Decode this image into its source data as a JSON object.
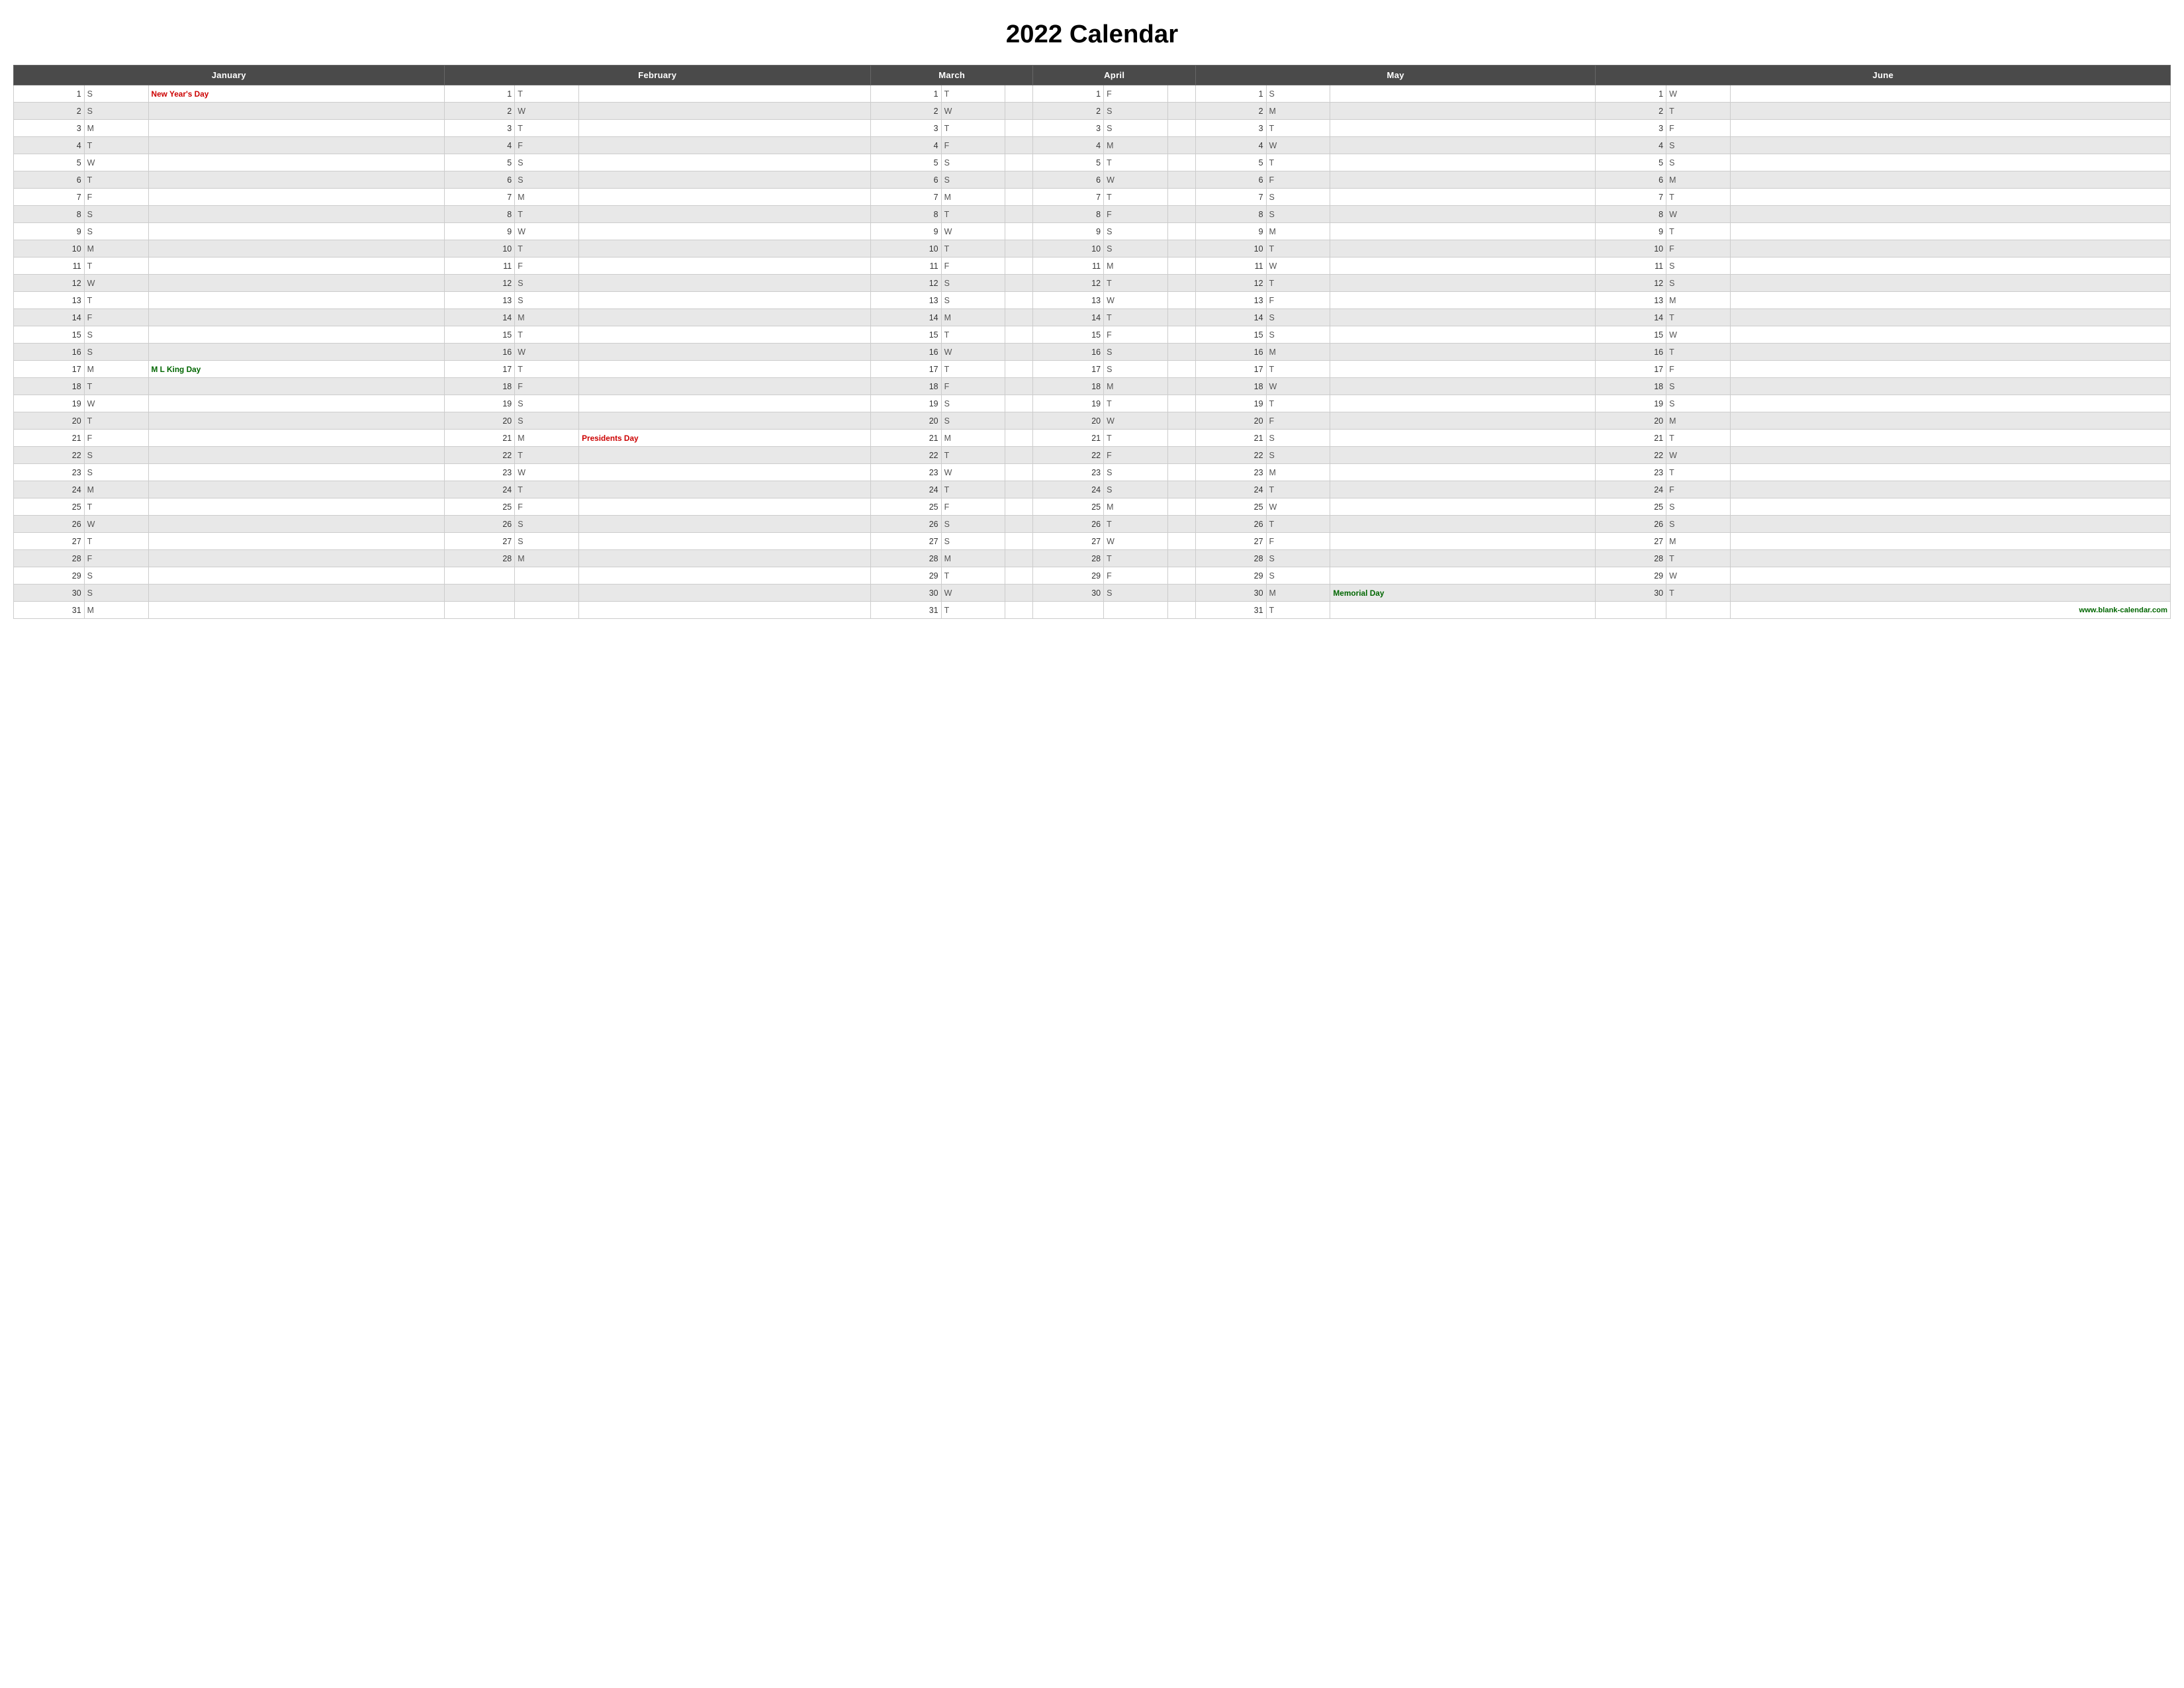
{
  "title": "2022 Calendar",
  "months": [
    "January",
    "February",
    "March",
    "April",
    "May",
    "June"
  ],
  "watermark": "www.blank-calendar.com",
  "rows": [
    {
      "jan": {
        "d": 1,
        "l": "S",
        "holiday": "New Year's Day",
        "hclass": "holiday-text"
      },
      "feb": {
        "d": 1,
        "l": "T",
        "holiday": ""
      },
      "mar": {
        "d": 1,
        "l": "T",
        "holiday": ""
      },
      "apr": {
        "d": 1,
        "l": "F",
        "holiday": ""
      },
      "may": {
        "d": 1,
        "l": "S",
        "holiday": ""
      },
      "jun": {
        "d": 1,
        "l": "W",
        "holiday": ""
      }
    },
    {
      "jan": {
        "d": 2,
        "l": "S",
        "holiday": ""
      },
      "feb": {
        "d": 2,
        "l": "W",
        "holiday": ""
      },
      "mar": {
        "d": 2,
        "l": "W",
        "holiday": ""
      },
      "apr": {
        "d": 2,
        "l": "S",
        "holiday": ""
      },
      "may": {
        "d": 2,
        "l": "M",
        "holiday": ""
      },
      "jun": {
        "d": 2,
        "l": "T",
        "holiday": ""
      }
    },
    {
      "jan": {
        "d": 3,
        "l": "M",
        "holiday": ""
      },
      "feb": {
        "d": 3,
        "l": "T",
        "holiday": ""
      },
      "mar": {
        "d": 3,
        "l": "T",
        "holiday": ""
      },
      "apr": {
        "d": 3,
        "l": "S",
        "holiday": ""
      },
      "may": {
        "d": 3,
        "l": "T",
        "holiday": ""
      },
      "jun": {
        "d": 3,
        "l": "F",
        "holiday": ""
      }
    },
    {
      "jan": {
        "d": 4,
        "l": "T",
        "holiday": ""
      },
      "feb": {
        "d": 4,
        "l": "F",
        "holiday": ""
      },
      "mar": {
        "d": 4,
        "l": "F",
        "holiday": ""
      },
      "apr": {
        "d": 4,
        "l": "M",
        "holiday": ""
      },
      "may": {
        "d": 4,
        "l": "W",
        "holiday": ""
      },
      "jun": {
        "d": 4,
        "l": "S",
        "holiday": ""
      }
    },
    {
      "jan": {
        "d": 5,
        "l": "W",
        "holiday": ""
      },
      "feb": {
        "d": 5,
        "l": "S",
        "holiday": ""
      },
      "mar": {
        "d": 5,
        "l": "S",
        "holiday": ""
      },
      "apr": {
        "d": 5,
        "l": "T",
        "holiday": ""
      },
      "may": {
        "d": 5,
        "l": "T",
        "holiday": ""
      },
      "jun": {
        "d": 5,
        "l": "S",
        "holiday": ""
      }
    },
    {
      "jan": {
        "d": 6,
        "l": "T",
        "holiday": ""
      },
      "feb": {
        "d": 6,
        "l": "S",
        "holiday": ""
      },
      "mar": {
        "d": 6,
        "l": "S",
        "holiday": ""
      },
      "apr": {
        "d": 6,
        "l": "W",
        "holiday": ""
      },
      "may": {
        "d": 6,
        "l": "F",
        "holiday": ""
      },
      "jun": {
        "d": 6,
        "l": "M",
        "holiday": ""
      }
    },
    {
      "jan": {
        "d": 7,
        "l": "F",
        "holiday": ""
      },
      "feb": {
        "d": 7,
        "l": "M",
        "holiday": ""
      },
      "mar": {
        "d": 7,
        "l": "M",
        "holiday": ""
      },
      "apr": {
        "d": 7,
        "l": "T",
        "holiday": ""
      },
      "may": {
        "d": 7,
        "l": "S",
        "holiday": ""
      },
      "jun": {
        "d": 7,
        "l": "T",
        "holiday": ""
      }
    },
    {
      "jan": {
        "d": 8,
        "l": "S",
        "holiday": ""
      },
      "feb": {
        "d": 8,
        "l": "T",
        "holiday": ""
      },
      "mar": {
        "d": 8,
        "l": "T",
        "holiday": ""
      },
      "apr": {
        "d": 8,
        "l": "F",
        "holiday": ""
      },
      "may": {
        "d": 8,
        "l": "S",
        "holiday": ""
      },
      "jun": {
        "d": 8,
        "l": "W",
        "holiday": ""
      }
    },
    {
      "jan": {
        "d": 9,
        "l": "S",
        "holiday": ""
      },
      "feb": {
        "d": 9,
        "l": "W",
        "holiday": ""
      },
      "mar": {
        "d": 9,
        "l": "W",
        "holiday": ""
      },
      "apr": {
        "d": 9,
        "l": "S",
        "holiday": ""
      },
      "may": {
        "d": 9,
        "l": "M",
        "holiday": ""
      },
      "jun": {
        "d": 9,
        "l": "T",
        "holiday": ""
      }
    },
    {
      "jan": {
        "d": 10,
        "l": "M",
        "holiday": ""
      },
      "feb": {
        "d": 10,
        "l": "T",
        "holiday": ""
      },
      "mar": {
        "d": 10,
        "l": "T",
        "holiday": ""
      },
      "apr": {
        "d": 10,
        "l": "S",
        "holiday": ""
      },
      "may": {
        "d": 10,
        "l": "T",
        "holiday": ""
      },
      "jun": {
        "d": 10,
        "l": "F",
        "holiday": ""
      }
    },
    {
      "jan": {
        "d": 11,
        "l": "T",
        "holiday": ""
      },
      "feb": {
        "d": 11,
        "l": "F",
        "holiday": ""
      },
      "mar": {
        "d": 11,
        "l": "F",
        "holiday": ""
      },
      "apr": {
        "d": 11,
        "l": "M",
        "holiday": ""
      },
      "may": {
        "d": 11,
        "l": "W",
        "holiday": ""
      },
      "jun": {
        "d": 11,
        "l": "S",
        "holiday": ""
      }
    },
    {
      "jan": {
        "d": 12,
        "l": "W",
        "holiday": ""
      },
      "feb": {
        "d": 12,
        "l": "S",
        "holiday": ""
      },
      "mar": {
        "d": 12,
        "l": "S",
        "holiday": ""
      },
      "apr": {
        "d": 12,
        "l": "T",
        "holiday": ""
      },
      "may": {
        "d": 12,
        "l": "T",
        "holiday": ""
      },
      "jun": {
        "d": 12,
        "l": "S",
        "holiday": ""
      }
    },
    {
      "jan": {
        "d": 13,
        "l": "T",
        "holiday": ""
      },
      "feb": {
        "d": 13,
        "l": "S",
        "holiday": ""
      },
      "mar": {
        "d": 13,
        "l": "S",
        "holiday": ""
      },
      "apr": {
        "d": 13,
        "l": "W",
        "holiday": ""
      },
      "may": {
        "d": 13,
        "l": "F",
        "holiday": ""
      },
      "jun": {
        "d": 13,
        "l": "M",
        "holiday": ""
      }
    },
    {
      "jan": {
        "d": 14,
        "l": "F",
        "holiday": ""
      },
      "feb": {
        "d": 14,
        "l": "M",
        "holiday": ""
      },
      "mar": {
        "d": 14,
        "l": "M",
        "holiday": ""
      },
      "apr": {
        "d": 14,
        "l": "T",
        "holiday": ""
      },
      "may": {
        "d": 14,
        "l": "S",
        "holiday": ""
      },
      "jun": {
        "d": 14,
        "l": "T",
        "holiday": ""
      }
    },
    {
      "jan": {
        "d": 15,
        "l": "S",
        "holiday": ""
      },
      "feb": {
        "d": 15,
        "l": "T",
        "holiday": ""
      },
      "mar": {
        "d": 15,
        "l": "T",
        "holiday": ""
      },
      "apr": {
        "d": 15,
        "l": "F",
        "holiday": ""
      },
      "may": {
        "d": 15,
        "l": "S",
        "holiday": ""
      },
      "jun": {
        "d": 15,
        "l": "W",
        "holiday": ""
      }
    },
    {
      "jan": {
        "d": 16,
        "l": "S",
        "holiday": ""
      },
      "feb": {
        "d": 16,
        "l": "W",
        "holiday": ""
      },
      "mar": {
        "d": 16,
        "l": "W",
        "holiday": ""
      },
      "apr": {
        "d": 16,
        "l": "S",
        "holiday": ""
      },
      "may": {
        "d": 16,
        "l": "M",
        "holiday": ""
      },
      "jun": {
        "d": 16,
        "l": "T",
        "holiday": ""
      }
    },
    {
      "jan": {
        "d": 17,
        "l": "M",
        "holiday": "M L King Day",
        "hclass": "holiday-green"
      },
      "feb": {
        "d": 17,
        "l": "T",
        "holiday": ""
      },
      "mar": {
        "d": 17,
        "l": "T",
        "holiday": ""
      },
      "apr": {
        "d": 17,
        "l": "S",
        "holiday": ""
      },
      "may": {
        "d": 17,
        "l": "T",
        "holiday": ""
      },
      "jun": {
        "d": 17,
        "l": "F",
        "holiday": ""
      }
    },
    {
      "jan": {
        "d": 18,
        "l": "T",
        "holiday": ""
      },
      "feb": {
        "d": 18,
        "l": "F",
        "holiday": ""
      },
      "mar": {
        "d": 18,
        "l": "F",
        "holiday": ""
      },
      "apr": {
        "d": 18,
        "l": "M",
        "holiday": ""
      },
      "may": {
        "d": 18,
        "l": "W",
        "holiday": ""
      },
      "jun": {
        "d": 18,
        "l": "S",
        "holiday": ""
      }
    },
    {
      "jan": {
        "d": 19,
        "l": "W",
        "holiday": ""
      },
      "feb": {
        "d": 19,
        "l": "S",
        "holiday": ""
      },
      "mar": {
        "d": 19,
        "l": "S",
        "holiday": ""
      },
      "apr": {
        "d": 19,
        "l": "T",
        "holiday": ""
      },
      "may": {
        "d": 19,
        "l": "T",
        "holiday": ""
      },
      "jun": {
        "d": 19,
        "l": "S",
        "holiday": ""
      }
    },
    {
      "jan": {
        "d": 20,
        "l": "T",
        "holiday": ""
      },
      "feb": {
        "d": 20,
        "l": "S",
        "holiday": ""
      },
      "mar": {
        "d": 20,
        "l": "S",
        "holiday": ""
      },
      "apr": {
        "d": 20,
        "l": "W",
        "holiday": ""
      },
      "may": {
        "d": 20,
        "l": "F",
        "holiday": ""
      },
      "jun": {
        "d": 20,
        "l": "M",
        "holiday": ""
      }
    },
    {
      "jan": {
        "d": 21,
        "l": "F",
        "holiday": ""
      },
      "feb": {
        "d": 21,
        "l": "M",
        "holiday": "Presidents Day",
        "hclass": "holiday-text"
      },
      "mar": {
        "d": 21,
        "l": "M",
        "holiday": ""
      },
      "apr": {
        "d": 21,
        "l": "T",
        "holiday": ""
      },
      "may": {
        "d": 21,
        "l": "S",
        "holiday": ""
      },
      "jun": {
        "d": 21,
        "l": "T",
        "holiday": ""
      }
    },
    {
      "jan": {
        "d": 22,
        "l": "S",
        "holiday": ""
      },
      "feb": {
        "d": 22,
        "l": "T",
        "holiday": ""
      },
      "mar": {
        "d": 22,
        "l": "T",
        "holiday": ""
      },
      "apr": {
        "d": 22,
        "l": "F",
        "holiday": ""
      },
      "may": {
        "d": 22,
        "l": "S",
        "holiday": ""
      },
      "jun": {
        "d": 22,
        "l": "W",
        "holiday": ""
      }
    },
    {
      "jan": {
        "d": 23,
        "l": "S",
        "holiday": ""
      },
      "feb": {
        "d": 23,
        "l": "W",
        "holiday": ""
      },
      "mar": {
        "d": 23,
        "l": "W",
        "holiday": ""
      },
      "apr": {
        "d": 23,
        "l": "S",
        "holiday": ""
      },
      "may": {
        "d": 23,
        "l": "M",
        "holiday": ""
      },
      "jun": {
        "d": 23,
        "l": "T",
        "holiday": ""
      }
    },
    {
      "jan": {
        "d": 24,
        "l": "M",
        "holiday": ""
      },
      "feb": {
        "d": 24,
        "l": "T",
        "holiday": ""
      },
      "mar": {
        "d": 24,
        "l": "T",
        "holiday": ""
      },
      "apr": {
        "d": 24,
        "l": "S",
        "holiday": ""
      },
      "may": {
        "d": 24,
        "l": "T",
        "holiday": ""
      },
      "jun": {
        "d": 24,
        "l": "F",
        "holiday": ""
      }
    },
    {
      "jan": {
        "d": 25,
        "l": "T",
        "holiday": ""
      },
      "feb": {
        "d": 25,
        "l": "F",
        "holiday": ""
      },
      "mar": {
        "d": 25,
        "l": "F",
        "holiday": ""
      },
      "apr": {
        "d": 25,
        "l": "M",
        "holiday": ""
      },
      "may": {
        "d": 25,
        "l": "W",
        "holiday": ""
      },
      "jun": {
        "d": 25,
        "l": "S",
        "holiday": ""
      }
    },
    {
      "jan": {
        "d": 26,
        "l": "W",
        "holiday": ""
      },
      "feb": {
        "d": 26,
        "l": "S",
        "holiday": ""
      },
      "mar": {
        "d": 26,
        "l": "S",
        "holiday": ""
      },
      "apr": {
        "d": 26,
        "l": "T",
        "holiday": ""
      },
      "may": {
        "d": 26,
        "l": "T",
        "holiday": ""
      },
      "jun": {
        "d": 26,
        "l": "S",
        "holiday": ""
      }
    },
    {
      "jan": {
        "d": 27,
        "l": "T",
        "holiday": ""
      },
      "feb": {
        "d": 27,
        "l": "S",
        "holiday": ""
      },
      "mar": {
        "d": 27,
        "l": "S",
        "holiday": ""
      },
      "apr": {
        "d": 27,
        "l": "W",
        "holiday": ""
      },
      "may": {
        "d": 27,
        "l": "F",
        "holiday": ""
      },
      "jun": {
        "d": 27,
        "l": "M",
        "holiday": ""
      }
    },
    {
      "jan": {
        "d": 28,
        "l": "F",
        "holiday": ""
      },
      "feb": {
        "d": 28,
        "l": "M",
        "holiday": ""
      },
      "mar": {
        "d": 28,
        "l": "M",
        "holiday": ""
      },
      "apr": {
        "d": 28,
        "l": "T",
        "holiday": ""
      },
      "may": {
        "d": 28,
        "l": "S",
        "holiday": ""
      },
      "jun": {
        "d": 28,
        "l": "T",
        "holiday": ""
      }
    },
    {
      "jan": {
        "d": 29,
        "l": "S",
        "holiday": ""
      },
      "feb": null,
      "mar": {
        "d": 29,
        "l": "T",
        "holiday": ""
      },
      "apr": {
        "d": 29,
        "l": "F",
        "holiday": ""
      },
      "may": {
        "d": 29,
        "l": "S",
        "holiday": ""
      },
      "jun": {
        "d": 29,
        "l": "W",
        "holiday": ""
      }
    },
    {
      "jan": {
        "d": 30,
        "l": "S",
        "holiday": ""
      },
      "feb": null,
      "mar": {
        "d": 30,
        "l": "W",
        "holiday": ""
      },
      "apr": {
        "d": 30,
        "l": "S",
        "holiday": ""
      },
      "may": {
        "d": 30,
        "l": "M",
        "holiday": "Memorial Day",
        "hclass": "holiday-green"
      },
      "jun": {
        "d": 30,
        "l": "T",
        "holiday": ""
      }
    },
    {
      "jan": {
        "d": 31,
        "l": "M",
        "holiday": ""
      },
      "feb": null,
      "mar": {
        "d": 31,
        "l": "T",
        "holiday": ""
      },
      "apr": null,
      "may": {
        "d": 31,
        "l": "T",
        "holiday": ""
      },
      "jun": null
    }
  ]
}
